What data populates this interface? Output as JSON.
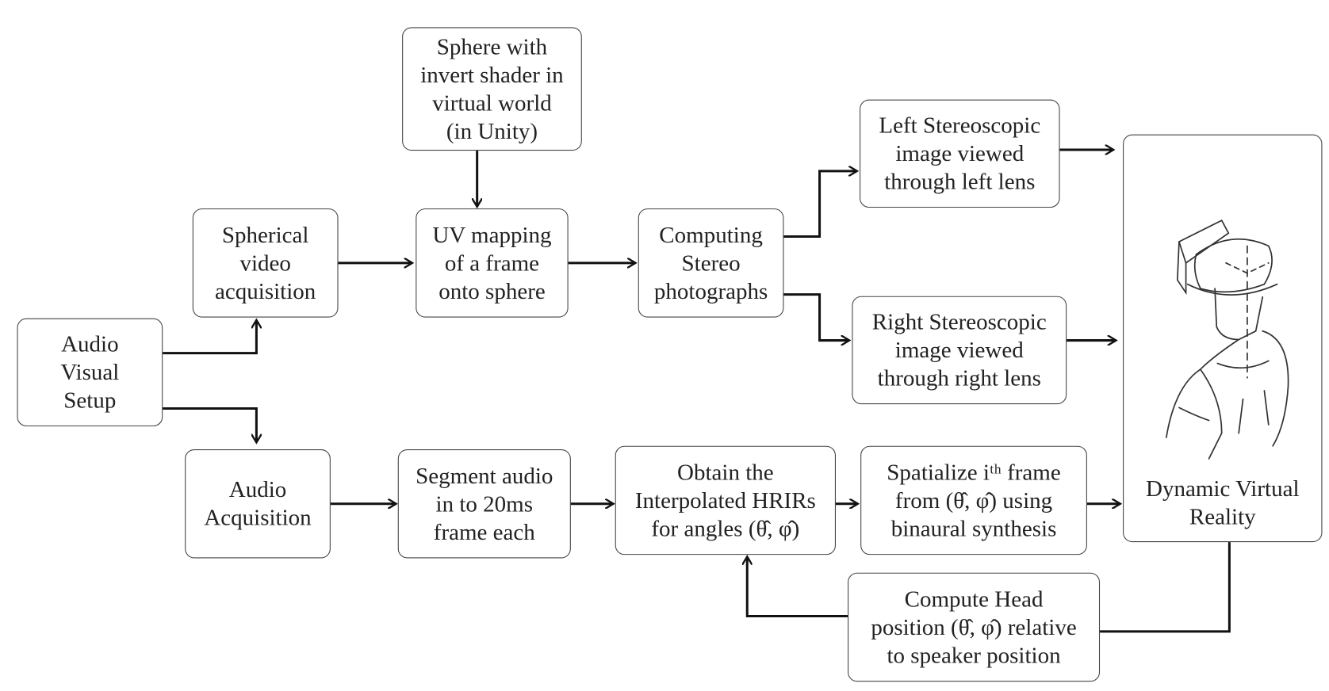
{
  "nodes": {
    "sphere": [
      "Sphere with",
      "invert shader in",
      "virtual world",
      "(in Unity)"
    ],
    "spherical_video": [
      "Spherical",
      "video",
      "acquisition"
    ],
    "uv_mapping": [
      "UV mapping",
      "of a frame",
      "onto sphere"
    ],
    "computing_stereo": [
      "Computing",
      "Stereo",
      "photographs"
    ],
    "left_stereo": [
      "Left Stereoscopic",
      "image viewed",
      "through left lens"
    ],
    "right_stereo": [
      "Right Stereoscopic",
      "image viewed",
      "through right lens"
    ],
    "dynamic_vr": [
      "Dynamic Virtual",
      "Reality"
    ],
    "av_setup": [
      "Audio",
      "Visual",
      "Setup"
    ],
    "audio_acq": [
      "Audio",
      "Acquisition"
    ],
    "segment_audio": [
      "Segment audio",
      "in to 20ms",
      "frame each"
    ],
    "obtain_hrirs": [
      "Obtain the",
      "Interpolated HRIRs",
      "for angles (θ̂, φ̂)"
    ],
    "spatialize": [
      "Spatialize iᵗʰ frame",
      "from (θ̂, φ̂) using",
      "binaural synthesis"
    ],
    "compute_head": [
      "Compute Head",
      "position (θ̂, φ̂) relative",
      "to speaker position"
    ]
  },
  "illustration": "person-wearing-vr-headset-sketch",
  "colors": {
    "stroke": "#111111",
    "box_border": "#444444"
  }
}
